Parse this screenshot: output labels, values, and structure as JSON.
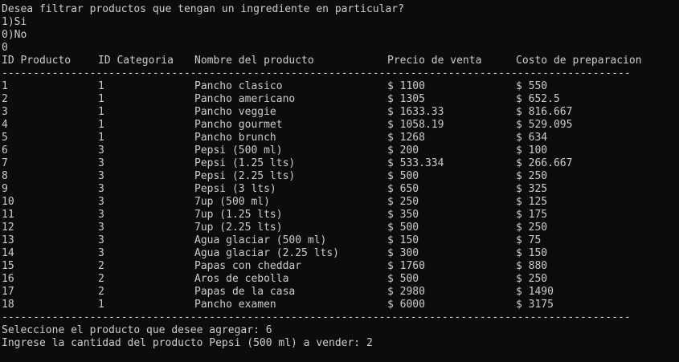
{
  "prompt": {
    "question": "Desea filtrar productos que tengan un ingrediente en particular?",
    "option_yes": "1)Si",
    "option_no": "0)No",
    "answer": "0"
  },
  "table": {
    "headers": [
      "ID Producto",
      "ID Categoria",
      "Nombre del producto",
      "Precio de venta",
      "Costo de preparacion"
    ],
    "separator": "----------------------------------------------------------------------------------------------------",
    "rows": [
      [
        "1",
        "1",
        "Pancho clasico",
        "$ 1100",
        "$ 550"
      ],
      [
        "2",
        "1",
        "Pancho americano",
        "$ 1305",
        "$ 652.5"
      ],
      [
        "3",
        "1",
        "Pancho veggie",
        "$ 1633.33",
        "$ 816.667"
      ],
      [
        "4",
        "1",
        "Pancho gourmet",
        "$ 1058.19",
        "$ 529.095"
      ],
      [
        "5",
        "1",
        "Pancho brunch",
        "$ 1268",
        "$ 634"
      ],
      [
        "6",
        "3",
        "Pepsi (500 ml)",
        "$ 200",
        "$ 100"
      ],
      [
        "7",
        "3",
        "Pepsi (1.25 lts)",
        "$ 533.334",
        "$ 266.667"
      ],
      [
        "8",
        "3",
        "Pepsi (2.25 lts)",
        "$ 500",
        "$ 250"
      ],
      [
        "9",
        "3",
        "Pepsi (3 lts)",
        "$ 650",
        "$ 325"
      ],
      [
        "10",
        "3",
        "7up (500 ml)",
        "$ 250",
        "$ 125"
      ],
      [
        "11",
        "3",
        "7up (1.25 lts)",
        "$ 350",
        "$ 175"
      ],
      [
        "12",
        "3",
        "7up (2.25 lts)",
        "$ 500",
        "$ 250"
      ],
      [
        "13",
        "3",
        "Agua glaciar (500 ml)",
        "$ 150",
        "$ 75"
      ],
      [
        "14",
        "3",
        "Agua glaciar (2.25 lts)",
        "$ 300",
        "$ 150"
      ],
      [
        "15",
        "2",
        "Papas con cheddar",
        "$ 1760",
        "$ 880"
      ],
      [
        "16",
        "2",
        "Aros de cebolla",
        "$ 500",
        "$ 250"
      ],
      [
        "17",
        "2",
        "Papas de la casa",
        "$ 2980",
        "$ 1490"
      ],
      [
        "18",
        "1",
        "Pancho examen",
        "$ 6000",
        "$ 3175"
      ]
    ]
  },
  "footer": {
    "select_prompt": "Seleccione el producto que desee agregar: 6",
    "quantity_prompt": "Ingrese la cantidad del producto Pepsi (500 ml) a vender: 2"
  },
  "colors": {
    "background": "#0c0c0c",
    "text": "#cccccc"
  }
}
